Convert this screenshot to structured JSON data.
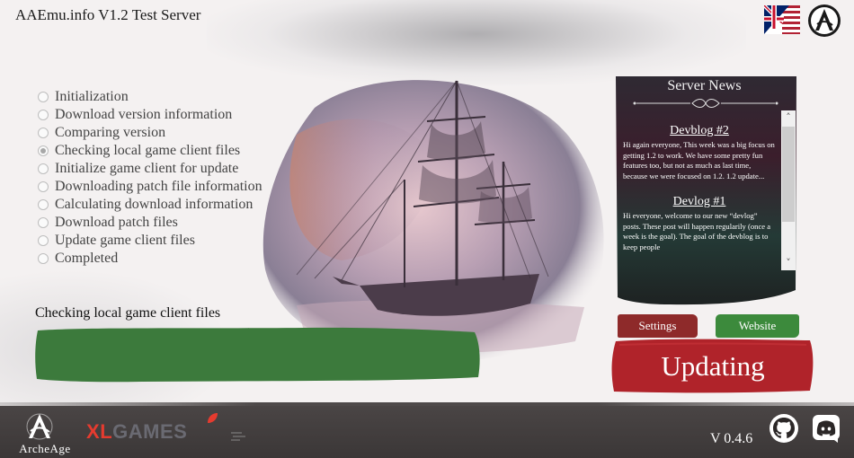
{
  "window": {
    "title": "AAEmu.info V1.2 Test Server"
  },
  "header": {
    "language_icon": "uk-us-flag-icon",
    "brand_icon": "aaemu-logo-icon"
  },
  "steps": [
    {
      "label": "Initialization",
      "state": "pending"
    },
    {
      "label": "Download version information",
      "state": "pending"
    },
    {
      "label": "Comparing version",
      "state": "pending"
    },
    {
      "label": "Checking local game client files",
      "state": "current"
    },
    {
      "label": "Initialize game client for update",
      "state": "pending"
    },
    {
      "label": "Downloading patch file information",
      "state": "pending"
    },
    {
      "label": "Calculating download information",
      "state": "pending"
    },
    {
      "label": "Download patch files",
      "state": "pending"
    },
    {
      "label": "Update game client files",
      "state": "pending"
    },
    {
      "label": "Completed",
      "state": "pending"
    }
  ],
  "status": {
    "label": "Checking local game client files",
    "progress": 1.0,
    "progress_color": "#3c7a3c"
  },
  "news": {
    "title": "Server News",
    "posts": [
      {
        "title": "Devblog #2",
        "body": "Hi again everyone, This week was a big focus on getting 1.2 to work. We have some pretty fun features too, but not as much as last time, because we were focused on 1.2. 1.2 update..."
      },
      {
        "title": "Devlog #1",
        "body": "Hi everyone, welcome to our new “devlog” posts. These post will happen regularily (once a week is the goal). The goal of the devblog is to keep people"
      }
    ],
    "scroll_up_icon": "chevron-up-icon",
    "scroll_down_icon": "chevron-down-icon"
  },
  "buttons": {
    "settings": "Settings",
    "website": "Website",
    "main": "Updating",
    "settings_color": "#8e2a2a",
    "website_color": "#3c8a3c",
    "main_color": "#b0232a"
  },
  "footer": {
    "archeage_label": "ArcheAge",
    "xlgames_x": "X",
    "xlgames_l": "L",
    "xlgames_rest": "GAMES",
    "version": "V 0.4.6",
    "github_icon": "github-icon",
    "discord_icon": "discord-icon"
  }
}
